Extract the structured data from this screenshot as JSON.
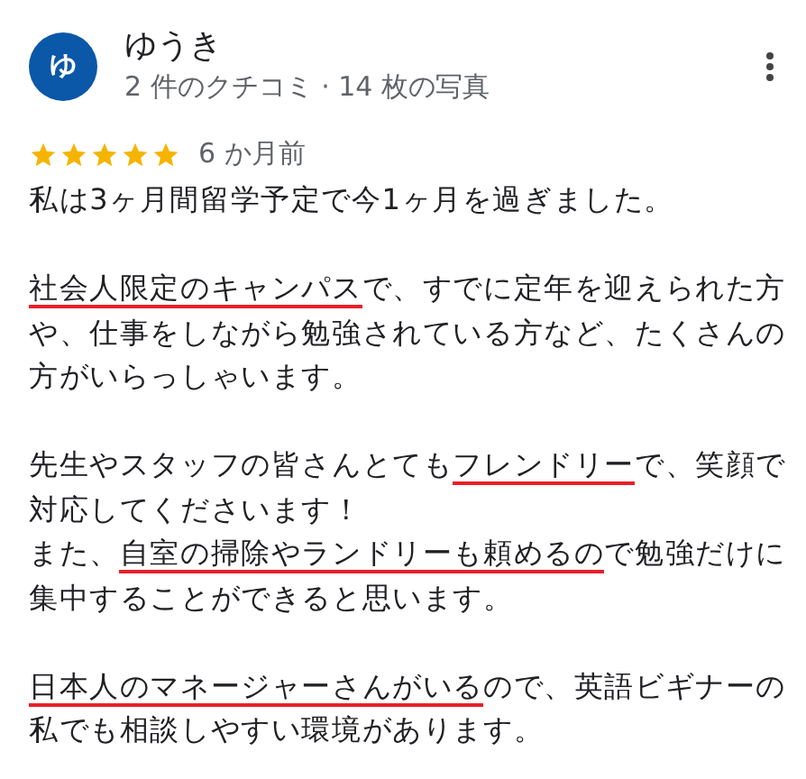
{
  "reviewer": {
    "avatar_letter": "ゆ",
    "name": "ゆうき",
    "meta": "2 件のクチコミ · 14 枚の写真"
  },
  "rating": {
    "stars": 5,
    "time": "6 か月前"
  },
  "paragraphs": [
    {
      "lines": [
        [
          {
            "text": "私は3ヶ月間留学予定で今1ヶ月を過ぎました。",
            "underlined": false
          }
        ]
      ]
    },
    {
      "lines": [
        [
          {
            "text": "社会人限定のキャンパス",
            "underlined": true
          },
          {
            "text": "で、すでに定年を迎えられた方や、仕事をしながら勉強されている方など、たくさんの方がいらっしゃいます。",
            "underlined": false
          }
        ]
      ]
    },
    {
      "lines": [
        [
          {
            "text": "先生やスタッフの皆さんとても",
            "underlined": false
          },
          {
            "text": "フレンドリー",
            "underlined": true
          },
          {
            "text": "で、笑顔で対応してくださいます！",
            "underlined": false
          }
        ],
        [
          {
            "text": "また、",
            "underlined": false
          },
          {
            "text": "自室の掃除やランドリーも頼めるの",
            "underlined": true
          },
          {
            "text": "で勉強だけに集中することができると思います。",
            "underlined": false
          }
        ]
      ]
    },
    {
      "lines": [
        [
          {
            "text": "日本人のマネージャーさんがいる",
            "underlined": true
          },
          {
            "text": "ので、英語ビギナーの私でも相談しやすい環境があります。",
            "underlined": false
          }
        ]
      ]
    }
  ]
}
